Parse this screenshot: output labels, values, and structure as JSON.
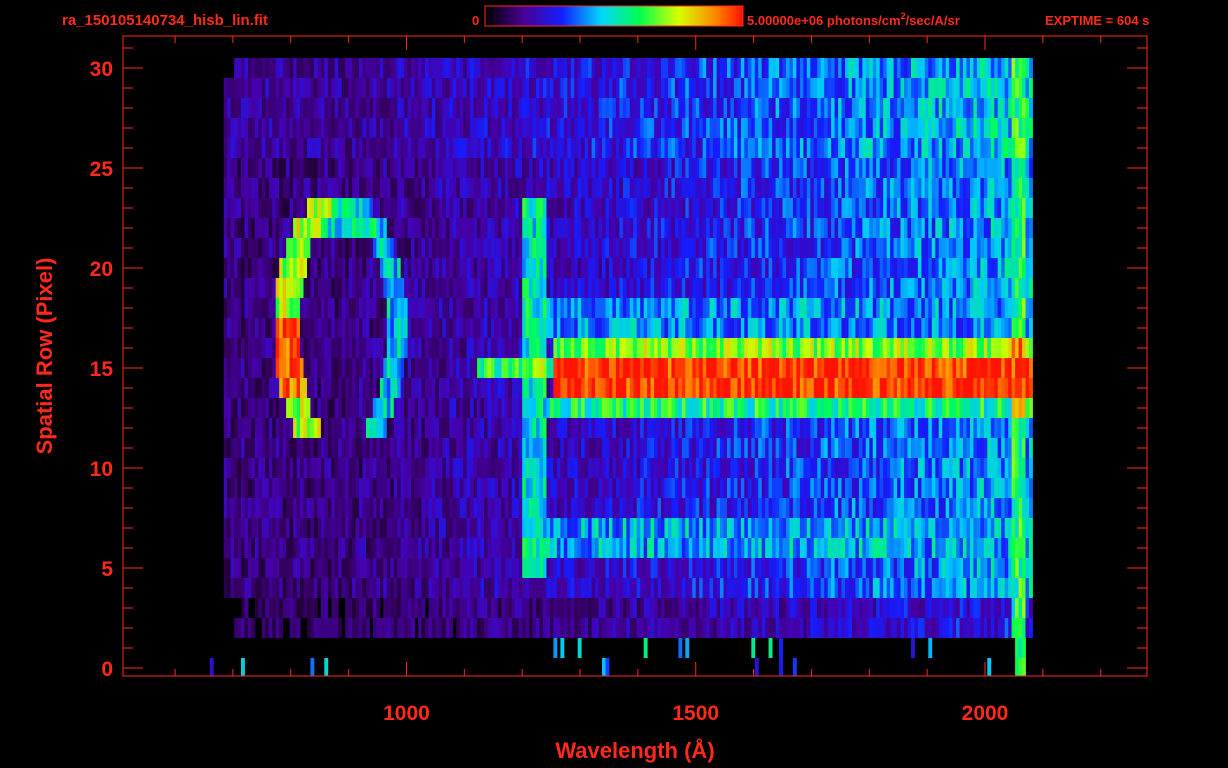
{
  "header": {
    "filename": "ra_150105140734_hisb_lin.fit",
    "colorbar_min": "0",
    "colorbar_max_prefix": "5.00000e+06 photons/cm",
    "colorbar_max_sup": "2",
    "colorbar_max_suffix": "/sec/A/sr",
    "exptime": "EXPTIME = 604 s"
  },
  "colors": {
    "axis": "#ff2a1a",
    "background": "#000000"
  },
  "chart_data": {
    "type": "heatmap",
    "title": "",
    "xlabel": "Wavelength (Å)",
    "ylabel": "Spatial Row (Pixel)",
    "xlim": [
      510,
      2280
    ],
    "ylim": [
      -0.4,
      31.6
    ],
    "x_ticks": [
      1000,
      1500,
      2000
    ],
    "x_tick_labels": [
      "1000",
      "1500",
      "2000"
    ],
    "y_ticks": [
      0,
      5,
      10,
      15,
      20,
      25,
      30
    ],
    "y_tick_labels": [
      "0",
      "5",
      "10",
      "15",
      "20",
      "25",
      "30"
    ],
    "colorbar": {
      "min": 0,
      "max": 5000000,
      "units": "photons/cm^2/sec/A/sr",
      "scale": "linear",
      "colormap": "rainbow"
    },
    "rows": [
      0,
      30
    ],
    "wavelength_range": [
      680,
      2080
    ],
    "features": [
      {
        "name": "Ly-alpha line",
        "wavelength": 1216,
        "rows": [
          5,
          24
        ],
        "level": 0.55
      },
      {
        "name": "arc feature",
        "wavelength_center": 900,
        "rows": [
          12,
          24
        ],
        "level": 0.6
      },
      {
        "name": "bright continuum",
        "wavelength": [
          1250,
          2060
        ],
        "rows": [
          14,
          16
        ],
        "level": 1.0
      },
      {
        "name": "secondary continuum",
        "wavelength": [
          1220,
          2060
        ],
        "rows": [
          6,
          8
        ],
        "level": 0.45
      },
      {
        "name": "red edge",
        "wavelength": 2060,
        "rows": [
          0,
          30
        ],
        "level": 0.7
      }
    ]
  }
}
